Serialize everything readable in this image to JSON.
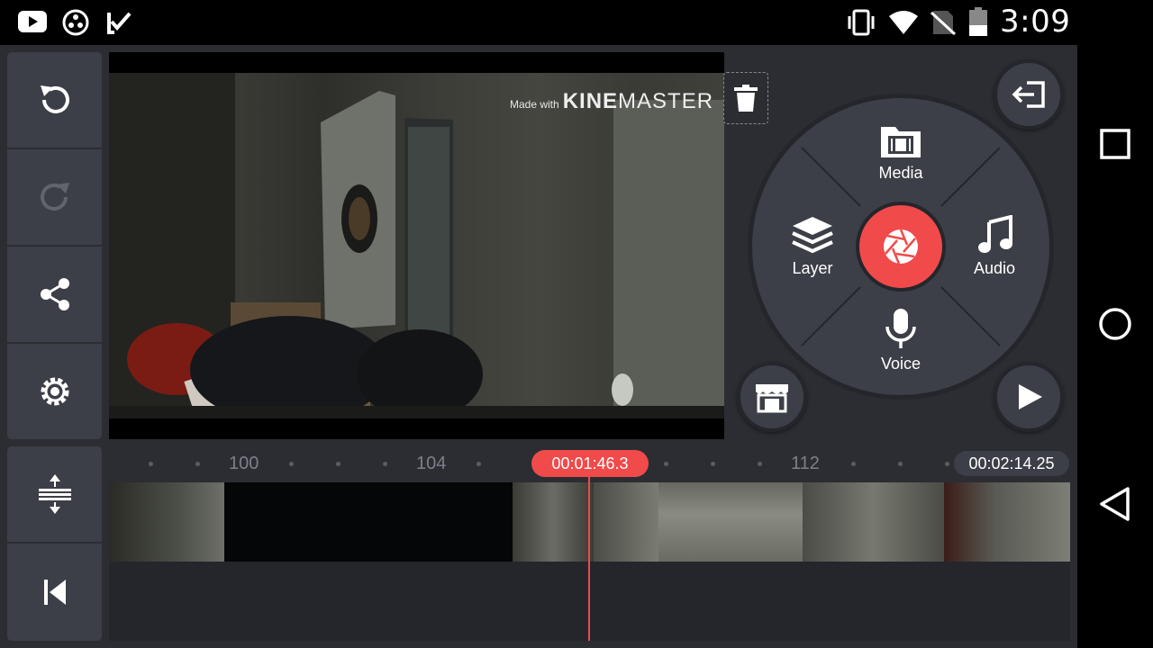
{
  "status_bar": {
    "time": "3:09",
    "left_icons": [
      "youtube-icon",
      "circles-icon",
      "checklist-icon"
    ],
    "right_icons": [
      "vibrate-icon",
      "wifi-icon",
      "no-signal-icon",
      "battery-icon"
    ]
  },
  "watermark": {
    "made_with": "Made with",
    "kine": "KINE",
    "master": "MASTER"
  },
  "wheel": {
    "media_label": "Media",
    "layer_label": "Layer",
    "audio_label": "Audio",
    "voice_label": "Voice"
  },
  "timeline": {
    "ticks": [
      "100",
      "104",
      "112"
    ],
    "current_time": "00:01:46.3",
    "total_time": "00:02:14.25"
  },
  "colors": {
    "accent": "#f04a4a",
    "panel": "#3c3f47",
    "background": "#2b2d33"
  },
  "icons": {
    "left_toolbar": [
      "undo-icon",
      "redo-icon",
      "share-icon",
      "settings-icon",
      "expand-timeline-icon",
      "skip-to-start-icon"
    ],
    "nav": [
      "recents-icon",
      "home-icon",
      "back-icon"
    ]
  }
}
